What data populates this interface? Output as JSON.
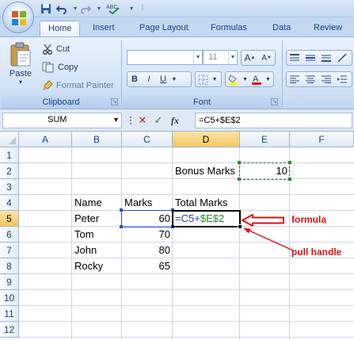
{
  "quick_access": {
    "save_icon": "save-icon",
    "undo_icon": "undo-icon",
    "redo_icon": "redo-icon",
    "spelling_icon": "spelling-icon"
  },
  "tabs": [
    {
      "label": "Home",
      "active": true
    },
    {
      "label": "Insert",
      "active": false
    },
    {
      "label": "Page Layout",
      "active": false
    },
    {
      "label": "Formulas",
      "active": false
    },
    {
      "label": "Data",
      "active": false
    },
    {
      "label": "Review",
      "active": false
    }
  ],
  "clipboard": {
    "paste_label": "Paste",
    "cut_label": "Cut",
    "copy_label": "Copy",
    "format_painter_label": "Format Painter",
    "group_label": "Clipboard"
  },
  "font": {
    "size_value": "11",
    "group_label": "Font",
    "grow_label": "A",
    "shrink_label": "A",
    "bold_label": "B",
    "italic_label": "I",
    "underline_label": "U"
  },
  "formula_bar": {
    "name_box": "SUM",
    "cancel_symbol": "✕",
    "enter_symbol": "✓",
    "fx_label": "fx",
    "formula": "=C5+$E$2"
  },
  "columns": [
    "A",
    "B",
    "C",
    "D",
    "E",
    "F"
  ],
  "rows": [
    "1",
    "2",
    "3",
    "4",
    "5",
    "6",
    "7",
    "8",
    "9",
    "10",
    "11",
    "12"
  ],
  "cells": {
    "D2": "Bonus Marks",
    "E2": "10",
    "B4": "Name",
    "C4": "Marks",
    "D4": "Total Marks",
    "B5": "Peter",
    "C5": "60",
    "D5_part1": "=C5+",
    "D5_part2": "$E$2",
    "B6": "Tom",
    "C6": "70",
    "B7": "John",
    "C7": "80",
    "B8": "Rocky",
    "C8": "65"
  },
  "annotations": {
    "formula_label": "formula",
    "pull_handle_label": "pull handle",
    "color": "#e01010"
  },
  "selection": {
    "active_cell": "D5",
    "active_column": "D",
    "active_row": "5"
  }
}
